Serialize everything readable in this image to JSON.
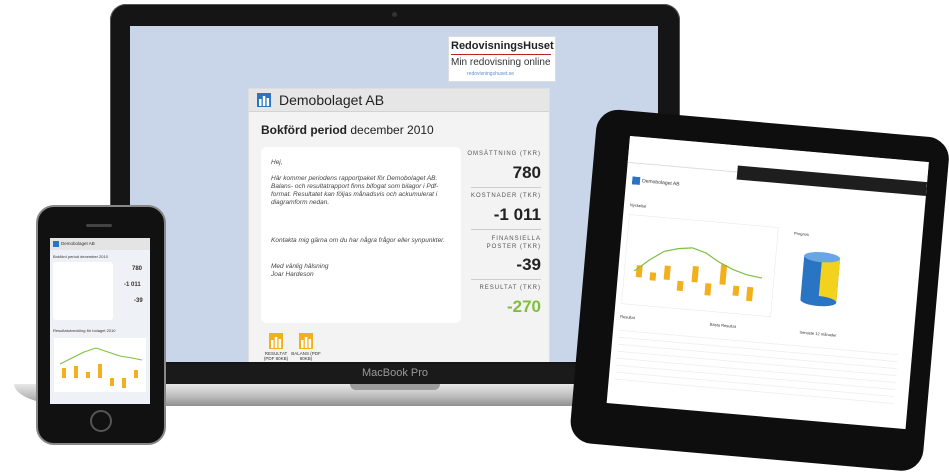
{
  "laptop": {
    "brand": "MacBook Pro",
    "logo": {
      "title": "RedovisningsHuset",
      "subtitle": "Min redovisning online",
      "url": "redovisningshuset.se"
    },
    "company": "Demobolaget AB",
    "period_label": "Bokförd period",
    "period_value": "december 2010",
    "letter": {
      "greeting": "Hej,",
      "body": "Här kommer periodens rapportpaket för Demobolaget AB. Balans- och resultatrapport finns bifogat som bilagor i Pdf-format. Resultatet kan följas månadsvis och ackumulerat i diagramform nedan.",
      "contact": "Kontakta mig gärna om du har några frågor eller synpunkter.",
      "closing": "Med vänlig hälsning",
      "signature": "Joar Hardeson"
    },
    "kpis": [
      {
        "label": "OMSÄTTNING (TKR)",
        "value": "780"
      },
      {
        "label": "KOSTNADER (TKR)",
        "value": "-1 011"
      },
      {
        "label": "FINANSIELLA POSTER (TKR)",
        "value": "-39"
      },
      {
        "label": "RESULTAT (TKR)",
        "value": "-270"
      }
    ],
    "documents": [
      {
        "label": "RESULTAT (PDF 80KB)"
      },
      {
        "label": "BALANS (PDF 80KB)"
      }
    ],
    "colors": {
      "result_value": "#7fbf3f",
      "icon_blue": "#2a74c4",
      "doc_yellow": "#f2b01d"
    }
  },
  "phone": {
    "company": "Demobolaget AB",
    "period": "Bokförd period december 2010",
    "kpis": [
      "780",
      "-1 011",
      "-39"
    ],
    "chart_title": "Resultatutveckling för bolaget 2010"
  },
  "tablet": {
    "company": "Demobolaget AB",
    "sections": [
      "Nyckeltal",
      "Resultat",
      "Prognos",
      "Bästa Resultat",
      "Senaste 12 månader"
    ]
  }
}
